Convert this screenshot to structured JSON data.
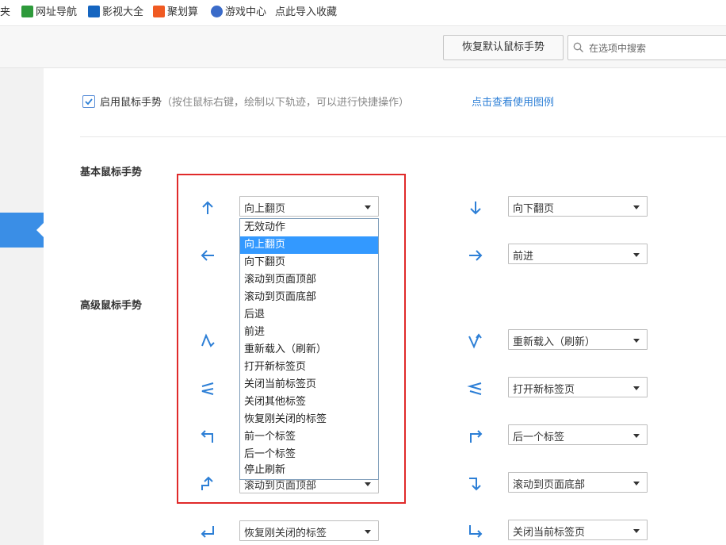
{
  "bookmarks": {
    "partial": "夹",
    "items": [
      {
        "label": "网址导航",
        "icon": "home-nav-icon"
      },
      {
        "label": "影视大全",
        "icon": "video-icon"
      },
      {
        "label": "聚划算",
        "icon": "ju-icon"
      },
      {
        "label": "游戏中心",
        "icon": "game-icon"
      },
      {
        "label": "点此导入收藏",
        "icon": ""
      }
    ]
  },
  "toolbar": {
    "restore_label": "恢复默认鼠标手势",
    "search_placeholder": "在选项中搜索"
  },
  "settings": {
    "enable_label": "启用鼠标手势",
    "enable_hint": "（按住鼠标右键，绘制以下轨迹，可以进行快捷操作）",
    "enable_checked": true,
    "help_link": "点击查看使用图例",
    "basic_title": "基本鼠标手势",
    "advanced_title": "高级鼠标手势"
  },
  "gestures": {
    "up": "向上翻页",
    "down": "向下翻页",
    "right": "前进",
    "down_up_right": "重新载入（刷新）",
    "left_right_left": "打开新标签页",
    "up_right": "后一个标签",
    "right_down": "滚动到页面底部",
    "up_left_covered": "滚动到页面顶部",
    "down_left": "恢复刚关闭的标签",
    "down_right": "关闭当前标签页"
  },
  "dropdown": {
    "selected_index": 1,
    "options": [
      "无效动作",
      "向上翻页",
      "向下翻页",
      "滚动到页面顶部",
      "滚动到页面底部",
      "后退",
      "前进",
      "重新载入（刷新）",
      "打开新标签页",
      "关闭当前标签页",
      "关闭其他标签",
      "恢复刚关闭的标签",
      "前一个标签",
      "后一个标签",
      "停止刷新"
    ]
  },
  "colors": {
    "accent": "#3a8ee6",
    "arrow": "#2d7fd6",
    "highlight": "#3399ff",
    "annotation_box": "#e02a2a"
  }
}
